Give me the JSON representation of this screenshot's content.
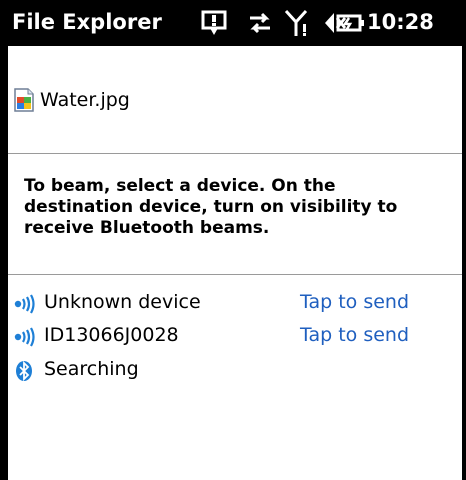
{
  "app": {
    "title": "File Explorer",
    "time": "10:28"
  },
  "file": {
    "name": "Water.jpg",
    "icon": "image-file-icon"
  },
  "instructions": "To beam, select a device. On the destination device, turn on visibility to receive Bluetooth beams.",
  "devices": [
    {
      "name": "Unknown device",
      "action": "Tap to send",
      "icon": "ir-beam-icon"
    },
    {
      "name": "ID13066J0028",
      "action": "Tap to send",
      "icon": "ir-beam-icon"
    }
  ],
  "status": {
    "label": "Searching",
    "icon": "bluetooth-icon"
  },
  "colors": {
    "titlebar": "#000000",
    "link": "#1f5fbf",
    "bluetooth": "#1e7fd6"
  }
}
